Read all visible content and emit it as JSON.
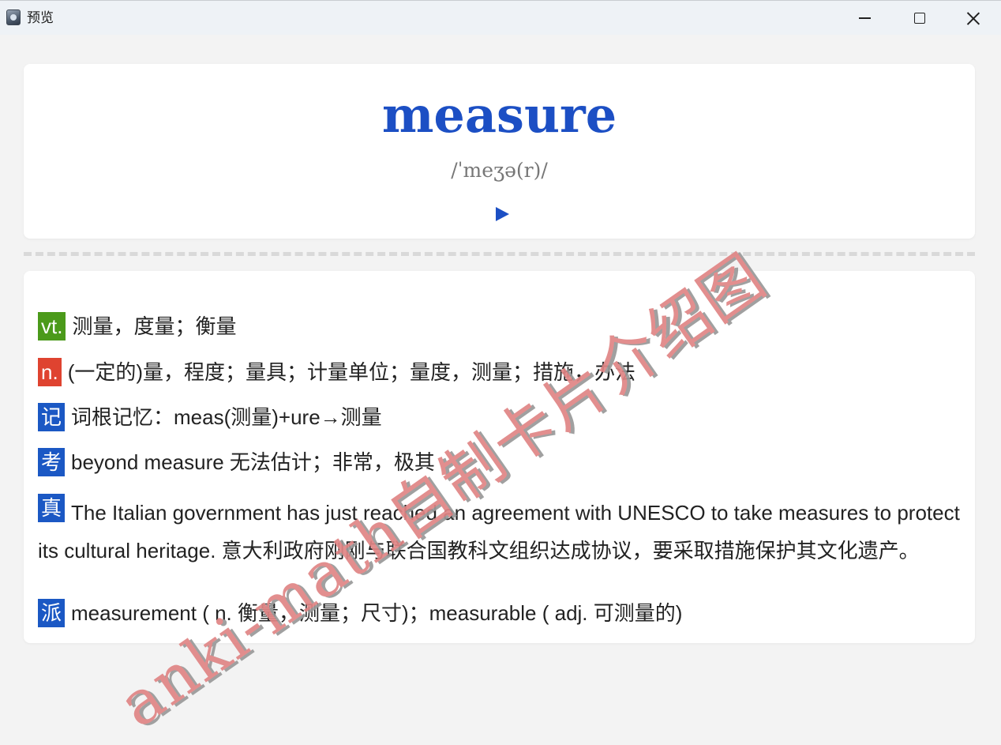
{
  "window": {
    "title": "预览"
  },
  "card": {
    "word": "measure",
    "phonetic": "/ˈmeʒə(r)/"
  },
  "entries": {
    "vt": {
      "tag": "vt.",
      "text": "测量，度量；衡量"
    },
    "n": {
      "tag": "n.",
      "text": "(一定的)量，程度；量具；计量单位；量度，测量；措施，办法"
    },
    "memory": {
      "tag": "记",
      "text": "词根记忆：meas(测量)+ure→测量"
    },
    "exam": {
      "tag": "考",
      "text": "beyond measure 无法估计；非常，极其"
    },
    "real": {
      "tag": "真",
      "text": "The Italian government has just reached an agreement with UNESCO to take measures to protect its cultural heritage. 意大利政府刚刚与联合国教科文组织达成协议，要采取措施保护其文化遗产。"
    },
    "derived": {
      "tag": "派",
      "text": "measurement ( n. 衡量，测量；尺寸)；measurable ( adj. 可测量的)"
    }
  },
  "watermark": "anki-math自制卡片介绍图",
  "colors": {
    "word": "#1c4fc4",
    "tag_green": "#4b9a1a",
    "tag_red": "#df4330",
    "tag_blue": "#1b58c4",
    "watermark": "#e08585"
  },
  "icons": {
    "app": "preview-app-icon",
    "play": "play-icon",
    "minimize": "minimize-icon",
    "maximize": "maximize-icon",
    "close": "close-icon"
  }
}
